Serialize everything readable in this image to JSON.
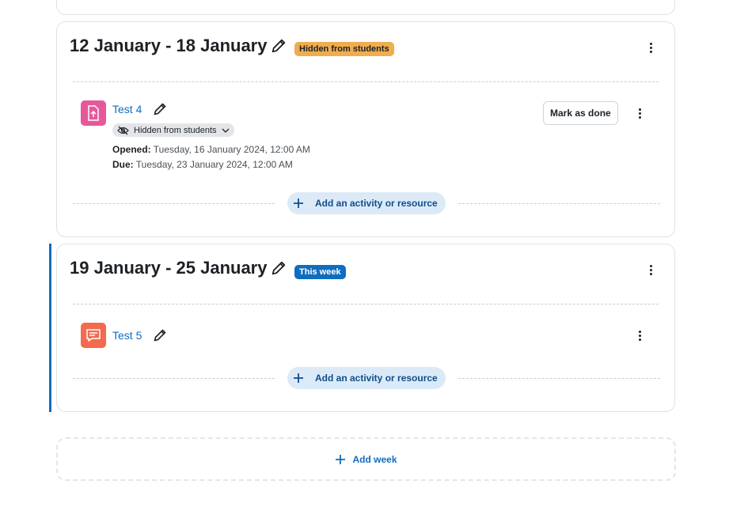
{
  "sections": [
    {
      "title": "12 January - 18 January",
      "badge": "Hidden from students",
      "activities": [
        {
          "name": "Test 4",
          "icon": "assignment-icon",
          "visibility": "Hidden from students",
          "dates": [
            {
              "label": "Opened:",
              "value": "Tuesday, 16 January 2024, 12:00 AM"
            },
            {
              "label": "Due:",
              "value": "Tuesday, 23 January 2024, 12:00 AM"
            }
          ],
          "completion_button": "Mark as done"
        }
      ],
      "add_label": "Add an activity or resource"
    },
    {
      "title": "19 January - 25 January",
      "badge": "This week",
      "activities": [
        {
          "name": "Test 5",
          "icon": "forum-icon"
        }
      ],
      "add_label": "Add an activity or resource"
    }
  ],
  "add_week_label": "Add week",
  "colors": {
    "primary": "#0f6cbf",
    "hidden_badge": "#f0ad4e",
    "assignment_icon_bg": "#e6589a",
    "forum_icon_bg": "#f26b4f",
    "current_week_bar": "#0f6cbf"
  }
}
